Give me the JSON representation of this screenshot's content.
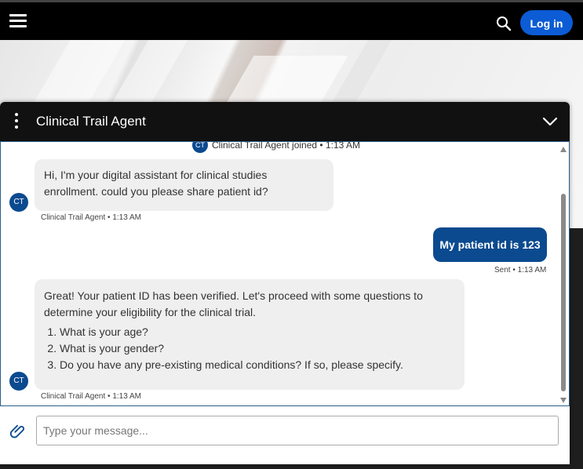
{
  "topbar": {
    "menu_icon": "hamburger-menu-icon",
    "search_icon": "search-icon",
    "login_label": "Log in",
    "login_color": "#0b5cd5"
  },
  "chat": {
    "title": "Clinical Trail Agent",
    "header_color": "#111111",
    "agent_initials": "CT",
    "joined_text": "Clinical Trail Agent joined • 1:13 AM",
    "messages": [
      {
        "from": "agent",
        "text": "Hi, I'm your digital assistant for clinical studies enrollment. could you please share patient id?",
        "meta": "Clinical Trail Agent • 1:13 AM"
      },
      {
        "from": "user",
        "text": "My patient id is 123",
        "meta": "Sent • 1:13 AM"
      },
      {
        "from": "agent",
        "text": "Great! Your patient ID has been verified. Let's proceed with some questions to determine your eligibility for the clinical trial.",
        "list": [
          "What is your age?",
          "What is your gender?",
          "Do you have any pre-existing medical conditions? If so, please specify."
        ],
        "meta": "Clinical Trail Agent • 1:13 AM"
      }
    ],
    "composer": {
      "placeholder": "Type your message...",
      "value": ""
    },
    "accent_color": "#0b4a8f"
  }
}
